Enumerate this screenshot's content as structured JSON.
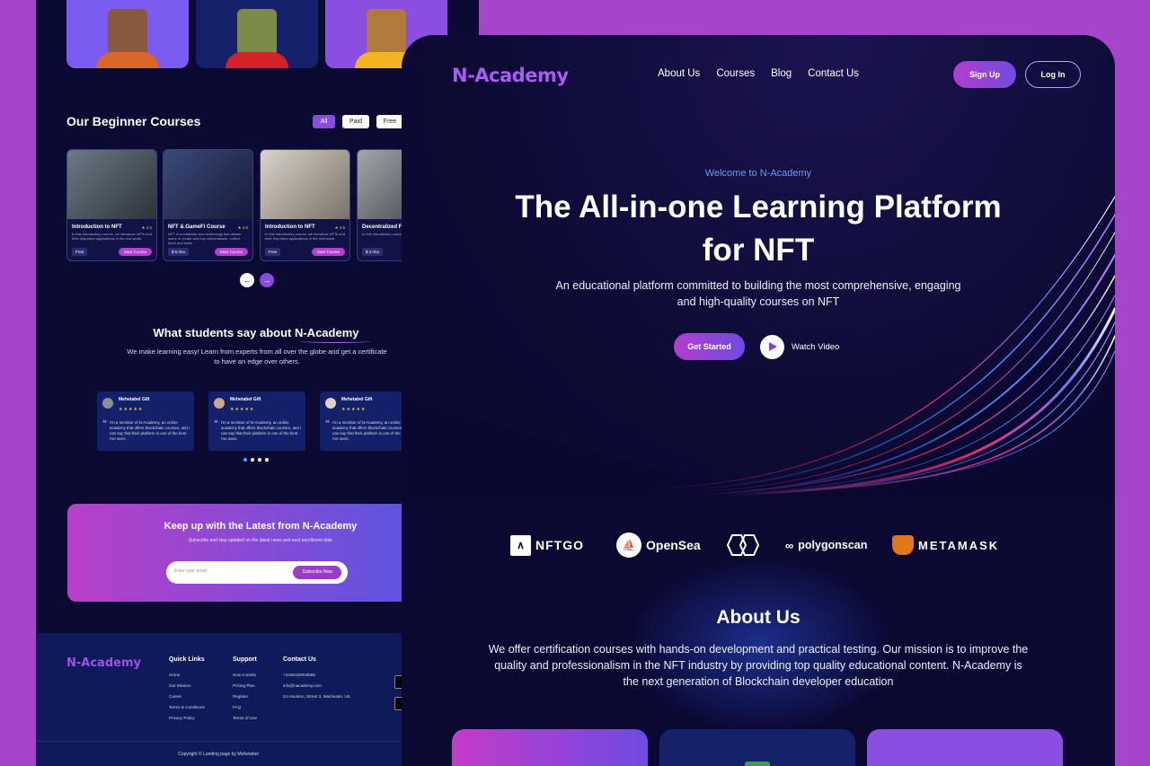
{
  "back": {
    "section_title": "Our Beginner Courses",
    "filters": [
      "All",
      "Paid",
      "Free"
    ],
    "courses": [
      {
        "title": "Introduction to NFT",
        "desc": "In this introductory course, we introduce NFTs and their important applications in the real world.",
        "tag": "Free",
        "button": "Start Course",
        "rating": "★ 4.5"
      },
      {
        "title": "NFT & GameFi Course",
        "desc": "NFT is a relatively new technology that allows users to create and buy virtual assets, collect them and trade.",
        "tag": "$ 5 /mo",
        "button": "Start Course",
        "rating": "★ 4.5"
      },
      {
        "title": "Introduction to NFT",
        "desc": "In this introductory course, we introduce NFTs and their important applications in the real world.",
        "tag": "Free",
        "button": "Start Course",
        "rating": "★ 4.5"
      },
      {
        "title": "Decentralized F",
        "desc": "In this introductory course, we introduce",
        "tag": "$ 4 /mo",
        "button": "",
        "rating": ""
      }
    ],
    "testimonials_title": "What students say about N-Academy",
    "testimonials_sub": "We make learning easy! Learn from experts from all over the globe and get a certificate to have an edge over others.",
    "reviews": [
      {
        "name": "Mehetabel Gift",
        "stars": "★★★★★",
        "text": "I'm a member of N-Academy, an online academy that offers blockchain courses, and I can say that their platform is one of the best I've seen."
      },
      {
        "name": "Mehetabel Gift",
        "stars": "★★★★★",
        "text": "I'm a member of N-Academy, an online academy that offers blockchain courses, and I can say that their platform is one of the best I've seen."
      },
      {
        "name": "Mehetabel Gift",
        "stars": "★★★★★",
        "text": "I'm a member of N-Academy, an online academy that offers blockchain courses, and I can say that their platform is one of the best I've seen."
      }
    ],
    "newsletter": {
      "title": "Keep up with the Latest from N-Academy",
      "sub": "Subscribe and stay updated on the latest news and next enrollment date",
      "placeholder": "Enter your email",
      "button": "Subscribe Now"
    },
    "footer": {
      "logo": "N-Academy",
      "quick_links": {
        "title": "Quick Links",
        "items": [
          "Home",
          "Our Mission",
          "Career",
          "Terms & Conditions",
          "Privacy Policy"
        ]
      },
      "support": {
        "title": "Support",
        "items": [
          "How it works",
          "Pricing Plan",
          "Register",
          "FAQ",
          "Terms of Use"
        ]
      },
      "contact": {
        "title": "Contact Us",
        "items": [
          "+2348150919585",
          "info@nacademy.com",
          "24 Houston, Street 3, Machester, UK"
        ]
      },
      "copyright": "Copyright © Landing page by Mehetabel"
    }
  },
  "front": {
    "brand": "N-Academy",
    "nav": [
      "About Us",
      "Courses",
      "Blog",
      "Contact Us"
    ],
    "signup": "Sign Up",
    "login": "Log In",
    "welcome": "Welcome to N-Academy",
    "hero_title": "The All-in-one Learning Platform for NFT",
    "hero_sub": "An educational platform committed to building the most comprehensive, engaging and high-quality courses on NFT",
    "get_started": "Get Started",
    "watch_video": "Watch Video",
    "partners": [
      "NFTGO",
      "OpenSea",
      "",
      "polygonscan",
      "METAMASK"
    ],
    "about_title": "About Us",
    "about_text": "We offer certification courses with hands-on development and practical testing. Our mission is to improve the quality and professionalism in the NFT industry by providing top quality educational content. N-Academy is the next generation of Blockchain developer education"
  },
  "colors": {
    "background": "#a645cc",
    "page": "#0b0832",
    "accent": "#a85cf0",
    "button_gradient_start": "#b43dcd",
    "button_gradient_end": "#6e4be2"
  }
}
